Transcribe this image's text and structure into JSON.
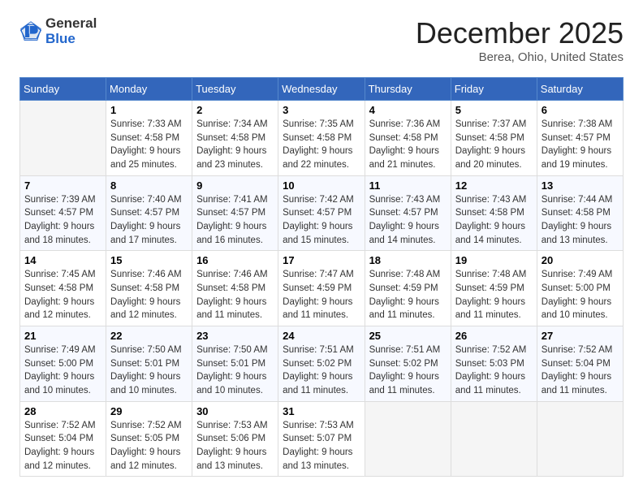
{
  "header": {
    "logo_line1": "General",
    "logo_line2": "Blue",
    "month_title": "December 2025",
    "location": "Berea, Ohio, United States"
  },
  "weekdays": [
    "Sunday",
    "Monday",
    "Tuesday",
    "Wednesday",
    "Thursday",
    "Friday",
    "Saturday"
  ],
  "weeks": [
    [
      {
        "day": "",
        "info": ""
      },
      {
        "day": "1",
        "info": "Sunrise: 7:33 AM\nSunset: 4:58 PM\nDaylight: 9 hours\nand 25 minutes."
      },
      {
        "day": "2",
        "info": "Sunrise: 7:34 AM\nSunset: 4:58 PM\nDaylight: 9 hours\nand 23 minutes."
      },
      {
        "day": "3",
        "info": "Sunrise: 7:35 AM\nSunset: 4:58 PM\nDaylight: 9 hours\nand 22 minutes."
      },
      {
        "day": "4",
        "info": "Sunrise: 7:36 AM\nSunset: 4:58 PM\nDaylight: 9 hours\nand 21 minutes."
      },
      {
        "day": "5",
        "info": "Sunrise: 7:37 AM\nSunset: 4:58 PM\nDaylight: 9 hours\nand 20 minutes."
      },
      {
        "day": "6",
        "info": "Sunrise: 7:38 AM\nSunset: 4:57 PM\nDaylight: 9 hours\nand 19 minutes."
      }
    ],
    [
      {
        "day": "7",
        "info": "Sunrise: 7:39 AM\nSunset: 4:57 PM\nDaylight: 9 hours\nand 18 minutes."
      },
      {
        "day": "8",
        "info": "Sunrise: 7:40 AM\nSunset: 4:57 PM\nDaylight: 9 hours\nand 17 minutes."
      },
      {
        "day": "9",
        "info": "Sunrise: 7:41 AM\nSunset: 4:57 PM\nDaylight: 9 hours\nand 16 minutes."
      },
      {
        "day": "10",
        "info": "Sunrise: 7:42 AM\nSunset: 4:57 PM\nDaylight: 9 hours\nand 15 minutes."
      },
      {
        "day": "11",
        "info": "Sunrise: 7:43 AM\nSunset: 4:57 PM\nDaylight: 9 hours\nand 14 minutes."
      },
      {
        "day": "12",
        "info": "Sunrise: 7:43 AM\nSunset: 4:58 PM\nDaylight: 9 hours\nand 14 minutes."
      },
      {
        "day": "13",
        "info": "Sunrise: 7:44 AM\nSunset: 4:58 PM\nDaylight: 9 hours\nand 13 minutes."
      }
    ],
    [
      {
        "day": "14",
        "info": "Sunrise: 7:45 AM\nSunset: 4:58 PM\nDaylight: 9 hours\nand 12 minutes."
      },
      {
        "day": "15",
        "info": "Sunrise: 7:46 AM\nSunset: 4:58 PM\nDaylight: 9 hours\nand 12 minutes."
      },
      {
        "day": "16",
        "info": "Sunrise: 7:46 AM\nSunset: 4:58 PM\nDaylight: 9 hours\nand 11 minutes."
      },
      {
        "day": "17",
        "info": "Sunrise: 7:47 AM\nSunset: 4:59 PM\nDaylight: 9 hours\nand 11 minutes."
      },
      {
        "day": "18",
        "info": "Sunrise: 7:48 AM\nSunset: 4:59 PM\nDaylight: 9 hours\nand 11 minutes."
      },
      {
        "day": "19",
        "info": "Sunrise: 7:48 AM\nSunset: 4:59 PM\nDaylight: 9 hours\nand 11 minutes."
      },
      {
        "day": "20",
        "info": "Sunrise: 7:49 AM\nSunset: 5:00 PM\nDaylight: 9 hours\nand 10 minutes."
      }
    ],
    [
      {
        "day": "21",
        "info": "Sunrise: 7:49 AM\nSunset: 5:00 PM\nDaylight: 9 hours\nand 10 minutes."
      },
      {
        "day": "22",
        "info": "Sunrise: 7:50 AM\nSunset: 5:01 PM\nDaylight: 9 hours\nand 10 minutes."
      },
      {
        "day": "23",
        "info": "Sunrise: 7:50 AM\nSunset: 5:01 PM\nDaylight: 9 hours\nand 10 minutes."
      },
      {
        "day": "24",
        "info": "Sunrise: 7:51 AM\nSunset: 5:02 PM\nDaylight: 9 hours\nand 11 minutes."
      },
      {
        "day": "25",
        "info": "Sunrise: 7:51 AM\nSunset: 5:02 PM\nDaylight: 9 hours\nand 11 minutes."
      },
      {
        "day": "26",
        "info": "Sunrise: 7:52 AM\nSunset: 5:03 PM\nDaylight: 9 hours\nand 11 minutes."
      },
      {
        "day": "27",
        "info": "Sunrise: 7:52 AM\nSunset: 5:04 PM\nDaylight: 9 hours\nand 11 minutes."
      }
    ],
    [
      {
        "day": "28",
        "info": "Sunrise: 7:52 AM\nSunset: 5:04 PM\nDaylight: 9 hours\nand 12 minutes."
      },
      {
        "day": "29",
        "info": "Sunrise: 7:52 AM\nSunset: 5:05 PM\nDaylight: 9 hours\nand 12 minutes."
      },
      {
        "day": "30",
        "info": "Sunrise: 7:53 AM\nSunset: 5:06 PM\nDaylight: 9 hours\nand 13 minutes."
      },
      {
        "day": "31",
        "info": "Sunrise: 7:53 AM\nSunset: 5:07 PM\nDaylight: 9 hours\nand 13 minutes."
      },
      {
        "day": "",
        "info": ""
      },
      {
        "day": "",
        "info": ""
      },
      {
        "day": "",
        "info": ""
      }
    ]
  ]
}
